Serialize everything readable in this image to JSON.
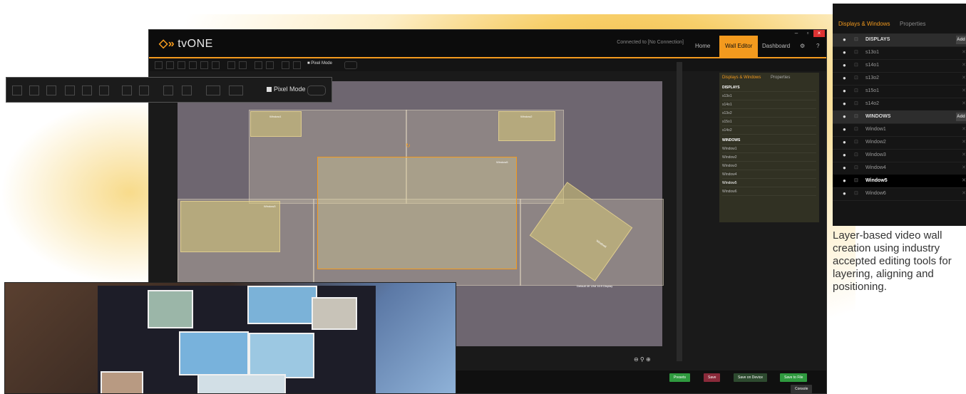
{
  "app": {
    "brand": "tvONE",
    "connection_status": "Connected to [No Connection]",
    "nav": [
      "Home",
      "Wall Editor",
      "Dashboard"
    ],
    "nav_active": "Wall Editor",
    "accent_color": "#f39a1e"
  },
  "toolbar": {
    "pixel_mode_label": "Pixel Mode"
  },
  "canvas": {
    "windows": [
      "Window1",
      "Window2",
      "Window3",
      "Window4",
      "Window5",
      "Window6"
    ],
    "default_display_label": "Default 4K Uhd 16:9 Display"
  },
  "panel": {
    "tabs": [
      "Displays & Windows",
      "Properties"
    ],
    "displays_header": "DISPLAYS",
    "displays": [
      "s13o1",
      "s14o1",
      "s13o2",
      "s15o1",
      "s14o2"
    ],
    "windows_header": "WINDOWS",
    "windows": [
      "Window1",
      "Window2",
      "Window3",
      "Window4",
      "Window5",
      "Window6"
    ],
    "selected_window": "Window5",
    "add_label": "Add"
  },
  "bottom_buttons": [
    "Presets",
    "Save",
    "Save on Device",
    "Save to File"
  ],
  "console_label": "Console",
  "caption": "Layer-based video wall creation using industry accepted editing tools for layering, aligning and positioning."
}
